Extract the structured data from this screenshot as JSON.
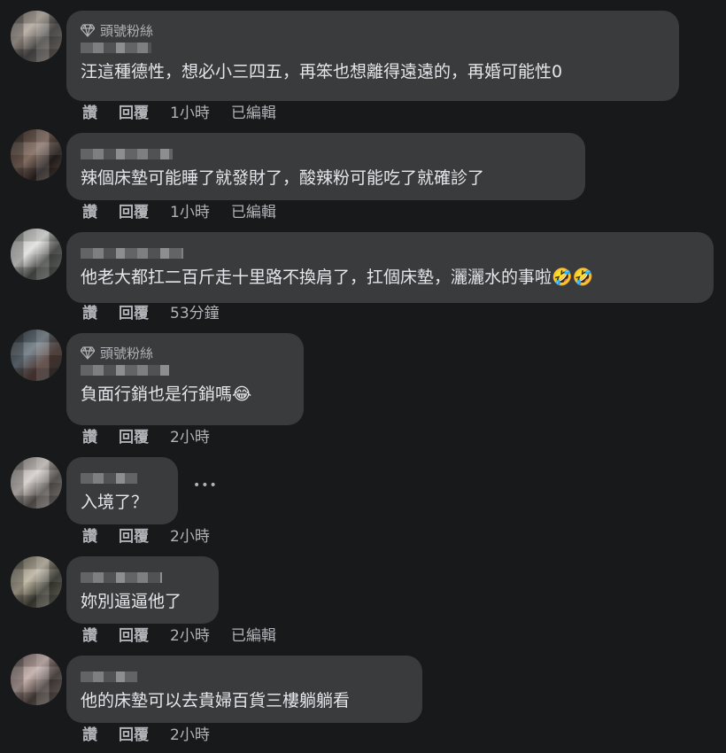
{
  "labels": {
    "like": "讚",
    "reply": "回覆",
    "edited": "已編輯",
    "top_fan": "頭號粉絲"
  },
  "comments": [
    {
      "badge": true,
      "text": "汪這種德性，想必小三四五，再笨也想離得遠遠的，再婚可能性0",
      "time": "1小時",
      "edited": true
    },
    {
      "badge": false,
      "text": "辣個床墊可能睡了就發財了，酸辣粉可能吃了就確診了",
      "time": "1小時",
      "edited": true
    },
    {
      "badge": false,
      "text": "他老大都扛二百斤走十里路不換肩了，扛個床墊，灑灑水的事啦🤣🤣",
      "time": "53分鐘",
      "edited": false
    },
    {
      "badge": true,
      "text": "負面行銷也是行銷嗎😂",
      "time": "2小時",
      "edited": false
    },
    {
      "badge": false,
      "text": "入境了？",
      "time": "2小時",
      "edited": false,
      "more": "•••"
    },
    {
      "badge": false,
      "text": "妳別逼逼他了",
      "time": "2小時",
      "edited": true
    },
    {
      "badge": false,
      "text": "他的床墊可以去貴婦百貨三樓躺躺看",
      "time": "2小時",
      "edited": false
    }
  ],
  "colors": {
    "background": "#18191a",
    "bubble": "#3a3b3c",
    "text": "#e4e6eb",
    "secondary": "#b0b3b8"
  }
}
